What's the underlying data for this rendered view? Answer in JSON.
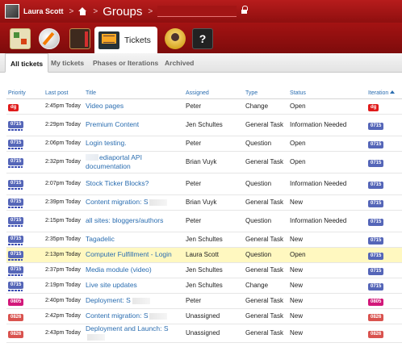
{
  "topbar": {
    "username": "Laura Scott",
    "breadcrumb_title": "Groups"
  },
  "toolbar": {
    "active_tab_label": "Tickets",
    "help_label": "?"
  },
  "subtabs": [
    "All tickets",
    "My tickets",
    "Phases or Iterations",
    "Archived"
  ],
  "table": {
    "columns": [
      "Priority",
      "Last post",
      "Title",
      "Assigned",
      "Type",
      "Status",
      "Iteration"
    ],
    "rows": [
      {
        "priority": "dg",
        "priority_color": "#e01b1b",
        "last_post": "2:45pm Today",
        "title": "Video pages",
        "assigned": "Peter",
        "type": "Change",
        "status": "Open",
        "iteration": "dg",
        "iteration_color": "#e01b1b",
        "lines": 1,
        "dots": false
      },
      {
        "priority": "0715",
        "priority_color": "#5566b8",
        "last_post": "2:29pm Today",
        "title": "Premium Content",
        "assigned": "Jen Schultes",
        "type": "General Task",
        "status": "Information Needed",
        "iteration": "0715",
        "iteration_color": "#5566b8",
        "lines": 2,
        "dots": true
      },
      {
        "priority": "0715",
        "priority_color": "#5566b8",
        "last_post": "2:06pm Today",
        "title": "Login testing.",
        "assigned": "Peter",
        "type": "Question",
        "status": "Open",
        "iteration": "0715",
        "iteration_color": "#5566b8",
        "lines": 1,
        "dots": true
      },
      {
        "priority": "0715",
        "priority_color": "#5566b8",
        "last_post": "2:32pm Today",
        "title": "ediaportal API documentation",
        "assigned": "Brian Vuyk",
        "type": "General Task",
        "status": "Open",
        "iteration": "0715",
        "iteration_color": "#5566b8",
        "lines": 2,
        "dots": true
      },
      {
        "priority": "0715",
        "priority_color": "#5566b8",
        "last_post": "2:07pm Today",
        "title": "Stock Ticker Blocks?",
        "assigned": "Peter",
        "type": "Question",
        "status": "Information Needed",
        "iteration": "0715",
        "iteration_color": "#5566b8",
        "lines": 2,
        "dots": true
      },
      {
        "priority": "0715",
        "priority_color": "#5566b8",
        "last_post": "2:39pm Today",
        "title": "Content migration: S",
        "assigned": "Brian Vuyk",
        "type": "General Task",
        "status": "New",
        "iteration": "0715",
        "iteration_color": "#5566b8",
        "lines": 1,
        "dots": true
      },
      {
        "priority": "0715",
        "priority_color": "#5566b8",
        "last_post": "2:15pm Today",
        "title": "all sites: bloggers/authors",
        "assigned": "Peter",
        "type": "Question",
        "status": "Information Needed",
        "iteration": "0715",
        "iteration_color": "#5566b8",
        "lines": 2,
        "dots": true
      },
      {
        "priority": "0715",
        "priority_color": "#5566b8",
        "last_post": "2:35pm Today",
        "title": "Tagadelic",
        "assigned": "Jen Schultes",
        "type": "General Task",
        "status": "New",
        "iteration": "0715",
        "iteration_color": "#5566b8",
        "lines": 1,
        "dots": true
      },
      {
        "priority": "0715",
        "priority_color": "#5566b8",
        "last_post": "2:13pm Today",
        "title": "Computer Fulfillment - Login",
        "assigned": "Laura Scott",
        "type": "Question",
        "status": "Open",
        "iteration": "0715",
        "iteration_color": "#5566b8",
        "lines": 1,
        "dots": true,
        "highlight": true
      },
      {
        "priority": "0715",
        "priority_color": "#5566b8",
        "last_post": "2:37pm Today",
        "title": "Media module (video)",
        "assigned": "Jen Schultes",
        "type": "General Task",
        "status": "New",
        "iteration": "0715",
        "iteration_color": "#5566b8",
        "lines": 1,
        "dots": true
      },
      {
        "priority": "0715",
        "priority_color": "#5566b8",
        "last_post": "2:19pm Today",
        "title": "Live site updates",
        "assigned": "Jen Schultes",
        "type": "Change",
        "status": "New",
        "iteration": "0715",
        "iteration_color": "#5566b8",
        "lines": 1,
        "dots": true
      },
      {
        "priority": "0805",
        "priority_color": "#d2187a",
        "last_post": "2:40pm Today",
        "title": "Deployment: S",
        "assigned": "Peter",
        "type": "General Task",
        "status": "New",
        "iteration": "0805",
        "iteration_color": "#d2187a",
        "lines": 1,
        "dots": false
      },
      {
        "priority": "0826",
        "priority_color": "#d9534f",
        "last_post": "2:42pm Today",
        "title": "Content migration: S",
        "assigned": "Unassigned",
        "type": "General Task",
        "status": "New",
        "iteration": "0826",
        "iteration_color": "#d9534f",
        "lines": 1,
        "dots": false
      },
      {
        "priority": "0826",
        "priority_color": "#d9534f",
        "last_post": "2:43pm Today",
        "title": "Deployment and Launch: S",
        "assigned": "Unassigned",
        "type": "General Task",
        "status": "New",
        "iteration": "0826",
        "iteration_color": "#d9534f",
        "lines": 1,
        "dots": false
      }
    ]
  }
}
